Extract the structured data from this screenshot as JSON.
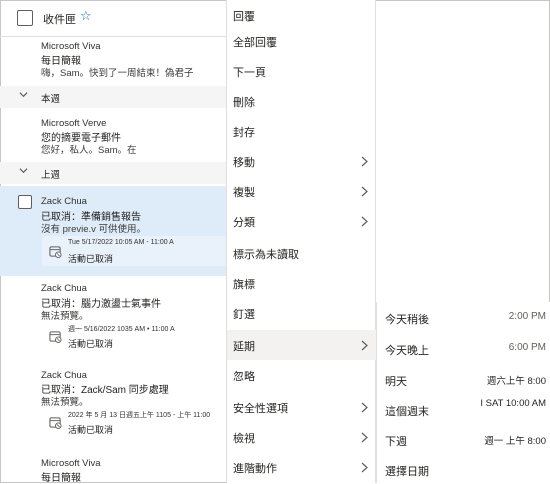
{
  "list": {
    "title": "收件匣",
    "groups": {
      "this_week": "本週",
      "last_week": "上週"
    },
    "messages": [
      {
        "sender": "Microsoft Viva",
        "subject": "每日簡報",
        "preview": "嗨，Sam。快到了一周結束！偽君子"
      },
      {
        "sender": "Microsoft Verve",
        "subject": "您的摘要電子郵件",
        "preview": "您好，私人。Sam。在"
      },
      {
        "sender": "Zack Chua",
        "subject": "已取消：準備銷售報告",
        "preview": "沒有 previe.v 可供使用。",
        "card_when": "Tue 5/17/2022 10:05 AM - 11:00 A",
        "card_event": "活動已取消"
      },
      {
        "sender": "Zack Chua",
        "subject": "已取消：腦力激盪士氣事件",
        "preview": "無法預覽。",
        "card_when": "週一 5/16/2022 1035 AM • 11:00 A",
        "card_event": "活動已取消"
      },
      {
        "sender": "Zack Chua",
        "subject": "已取消：Zack/Sam 同步處理",
        "preview": "無法預覽。",
        "card_when": "2022 年 5 月 13 日週五上午 1105 - 上午 11:00",
        "card_event": "活動已取消"
      },
      {
        "sender": "Microsoft Viva",
        "subject": "每日簡報",
        "preview": ""
      }
    ]
  },
  "menu": {
    "items": [
      {
        "label": "回覆",
        "submenu": false
      },
      {
        "label": "全部回覆",
        "submenu": false
      },
      {
        "label": "下一頁",
        "submenu": false
      },
      {
        "label": "刪除",
        "submenu": false
      },
      {
        "label": "封存",
        "submenu": false
      },
      {
        "label": "移動",
        "submenu": true
      },
      {
        "label": "複製",
        "submenu": true
      },
      {
        "label": "分類",
        "submenu": true
      },
      {
        "label": "標示為未讀取",
        "submenu": false
      },
      {
        "label": "旗標",
        "submenu": false
      },
      {
        "label": "釘選",
        "submenu": false
      },
      {
        "label": "延期",
        "submenu": true
      },
      {
        "label": "忽略",
        "submenu": false
      },
      {
        "label": "安全性選項",
        "submenu": true
      },
      {
        "label": "檢視",
        "submenu": true
      },
      {
        "label": "進階動作",
        "submenu": true
      }
    ]
  },
  "snooze": {
    "items": [
      {
        "label": "今天稍後",
        "time": "2:00 PM"
      },
      {
        "label": "今天晚上",
        "time": "6:00 PM"
      },
      {
        "label": "明天",
        "time": "週六上午 8:00"
      },
      {
        "label": "這個週末",
        "time": "I SAT 10:00 AM"
      },
      {
        "label": "下週",
        "time": "週一 上午 8:00"
      },
      {
        "label": "選擇日期",
        "time": ""
      }
    ]
  },
  "colors": {
    "accent": "#0f6cbd",
    "selected_row": "#deecf9",
    "hover_item": "#f3f2f1"
  },
  "icons": {
    "star": "star-icon",
    "chevron": "chevron-down-icon",
    "submenu_arrow": "chevron-right-icon",
    "event": "calendar-cancel-icon"
  }
}
